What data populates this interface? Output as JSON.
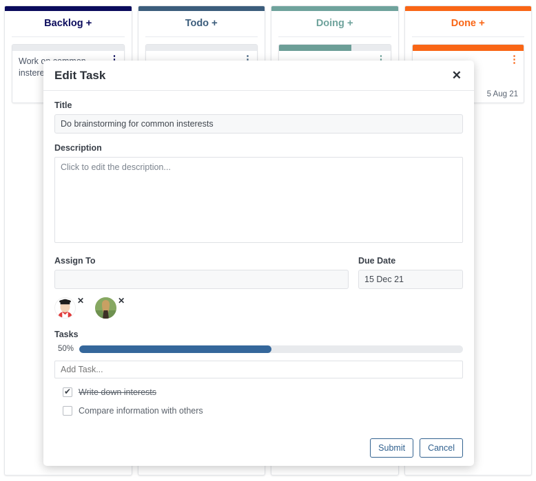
{
  "board": {
    "columns": [
      {
        "name": "Backlog",
        "title": "Backlog",
        "add_label": "+",
        "accent": "#0b0b5c",
        "title_color": "#0b0b5c",
        "cards": [
          {
            "title": "Work on common insterests",
            "progress": 0,
            "bar_color": "#0b0b5c",
            "date": "",
            "menu": "⋮"
          }
        ]
      },
      {
        "name": "Todo",
        "title": "Todo",
        "add_label": "+",
        "accent": "#3c5d7c",
        "title_color": "#3c5d7c",
        "cards": [
          {
            "title": "",
            "progress": 0,
            "bar_color": "#3c5d7c",
            "date": "",
            "menu": "⋮"
          }
        ]
      },
      {
        "name": "Doing",
        "title": "Doing",
        "add_label": "+",
        "accent": "#6fa39c",
        "title_color": "#6fa39c",
        "cards": [
          {
            "title": "",
            "progress": 65,
            "bar_color": "#6c9e97",
            "date": "",
            "menu": "⋮"
          }
        ]
      },
      {
        "name": "Done",
        "title": "Done",
        "add_label": "+",
        "accent": "#f96616",
        "title_color": "#f96616",
        "cards": [
          {
            "title": "",
            "progress": 100,
            "bar_color": "#f96616",
            "date": "5 Aug 21",
            "menu": "⋮"
          }
        ]
      }
    ]
  },
  "modal": {
    "title": "Edit Task",
    "close_icon": "✕",
    "fields": {
      "title_label": "Title",
      "title_value": "Do brainstorming for common insterests",
      "title_placeholder": "",
      "description_label": "Description",
      "description_value": "",
      "description_placeholder": "Click to edit the description...",
      "assign_label": "Assign To",
      "assign_value": "",
      "assign_placeholder": "",
      "due_label": "Due Date",
      "due_value": "15 Dec 21",
      "due_placeholder": ""
    },
    "assignees": [
      {
        "name": "assignee-1",
        "glyph": "👳",
        "remove_icon": "✕"
      },
      {
        "name": "assignee-2",
        "glyph": "👱‍♀️",
        "remove_icon": "✕"
      }
    ],
    "tasks": {
      "label": "Tasks",
      "progress_pct_label": "50%",
      "progress_value": 50,
      "progress_color": "#35679b",
      "add_placeholder": "Add Task...",
      "add_value": "",
      "items": [
        {
          "label": "Write down interests",
          "checked": true,
          "check_icon": "✔"
        },
        {
          "label": "Compare information with others",
          "checked": false,
          "check_icon": ""
        }
      ]
    },
    "footer": {
      "submit_label": "Submit",
      "cancel_label": "Cancel"
    }
  }
}
